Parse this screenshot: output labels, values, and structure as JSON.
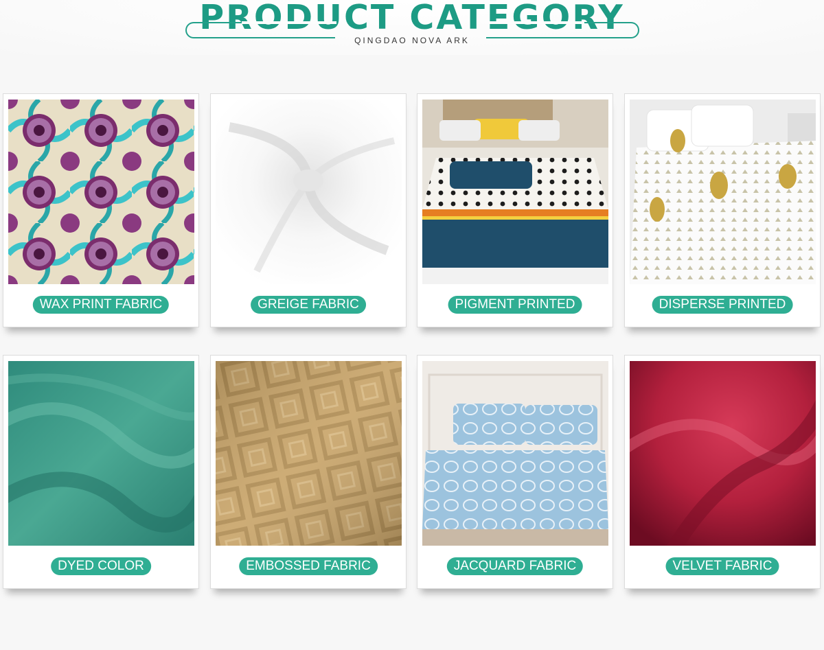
{
  "header": {
    "title": "PRODUCT CATEGORY",
    "subtitle": "QINGDAO NOVA ARK",
    "accent_color": "#1d9b84"
  },
  "products": [
    {
      "label": "WAX PRINT FABRIC",
      "image": "wax-print-fabric-image"
    },
    {
      "label": "GREIGE FABRIC",
      "image": "greige-fabric-image"
    },
    {
      "label": "PIGMENT PRINTED",
      "image": "pigment-printed-bedding-image"
    },
    {
      "label": "DISPERSE PRINTED",
      "image": "disperse-printed-bedding-image"
    },
    {
      "label": "DYED COLOR",
      "image": "dyed-color-fabric-image"
    },
    {
      "label": "EMBOSSED FABRIC",
      "image": "embossed-fabric-image"
    },
    {
      "label": "JACQUARD FABRIC",
      "image": "jacquard-bedding-image"
    },
    {
      "label": "VELVET FABRIC",
      "image": "velvet-fabric-image"
    }
  ],
  "label_color": "#2fae93"
}
